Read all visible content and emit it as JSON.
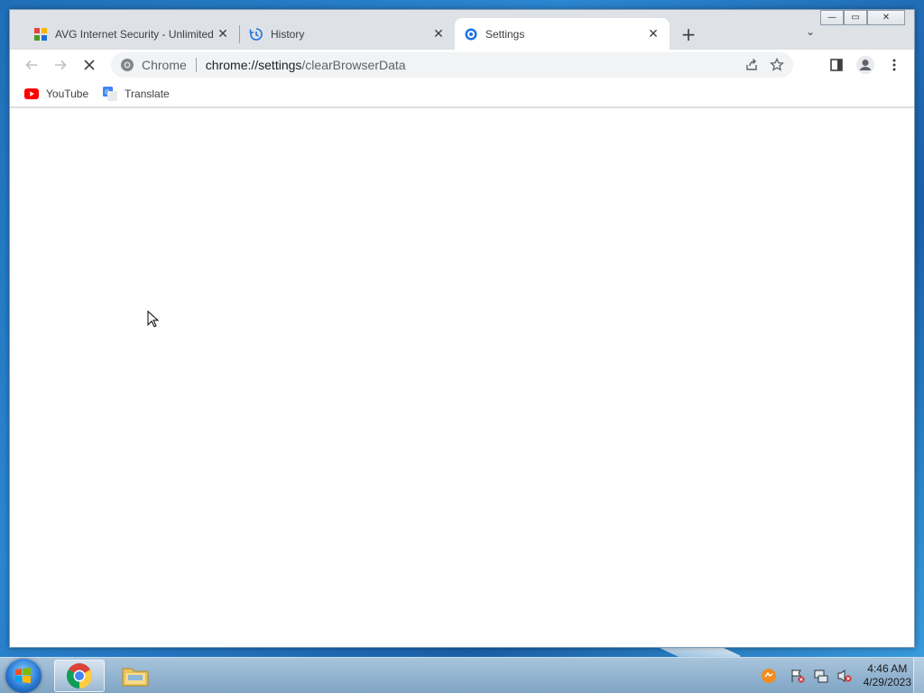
{
  "window": {
    "controls": {
      "minimize": "—",
      "maximize": "▭",
      "close": "✕"
    }
  },
  "tabs": [
    {
      "title": "AVG Internet Security - Unlimited",
      "icon": "avg-icon",
      "active": false
    },
    {
      "title": "History",
      "icon": "history-icon",
      "active": false
    },
    {
      "title": "Settings",
      "icon": "settings-gear-icon",
      "active": true
    }
  ],
  "tab_close_glyph": "✕",
  "new_tab_glyph": "+",
  "tab_search_glyph": "⌄",
  "omnibox": {
    "site_label": "Chrome",
    "url_host": "chrome://settings",
    "url_path": "/clearBrowserData"
  },
  "bookmarks": [
    {
      "label": "YouTube",
      "icon": "youtube-icon"
    },
    {
      "label": "Translate",
      "icon": "google-translate-icon"
    }
  ],
  "taskbar": {
    "clock_time": "4:46 AM",
    "clock_date": "4/29/2023"
  },
  "colors": {
    "accent": "#1a73e8",
    "youtube_red": "#ff0000",
    "tab_strip": "#dee1e6"
  }
}
